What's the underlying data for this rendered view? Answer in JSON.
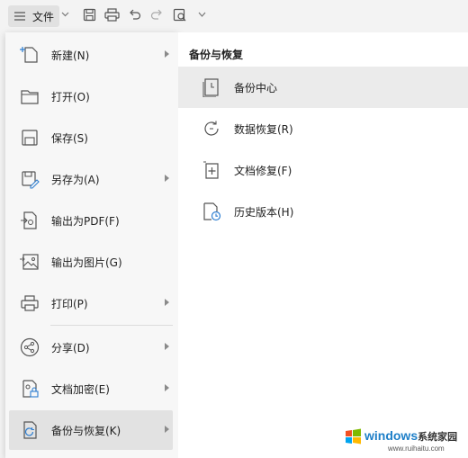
{
  "toolbar": {
    "file_label": "文件",
    "icons": [
      "menu-icon",
      "chevron-down-icon",
      "save-icon",
      "print-icon",
      "undo-icon",
      "redo-icon",
      "print-preview-icon",
      "more-icon"
    ]
  },
  "menu": {
    "items": [
      {
        "label": "新建(N)",
        "icon": "new-file-icon",
        "has_submenu": true
      },
      {
        "label": "打开(O)",
        "icon": "folder-icon",
        "has_submenu": false
      },
      {
        "label": "保存(S)",
        "icon": "save-icon",
        "has_submenu": false
      },
      {
        "label": "另存为(A)",
        "icon": "save-as-icon",
        "has_submenu": true
      },
      {
        "label": "输出为PDF(F)",
        "icon": "pdf-export-icon",
        "has_submenu": false
      },
      {
        "label": "输出为图片(G)",
        "icon": "image-export-icon",
        "has_submenu": false
      },
      {
        "label": "打印(P)",
        "icon": "print-icon",
        "has_submenu": true
      },
      {
        "label": "分享(D)",
        "icon": "share-icon",
        "has_submenu": true
      },
      {
        "label": "文档加密(E)",
        "icon": "lock-document-icon",
        "has_submenu": true
      },
      {
        "label": "备份与恢复(K)",
        "icon": "backup-icon",
        "has_submenu": true,
        "active": true
      }
    ]
  },
  "submenu": {
    "title": "备份与恢复",
    "items": [
      {
        "label": "备份中心",
        "icon": "backup-center-icon",
        "active": true
      },
      {
        "label": "数据恢复(R)",
        "icon": "data-recovery-icon"
      },
      {
        "label": "文档修复(F)",
        "icon": "document-repair-icon"
      },
      {
        "label": "历史版本(H)",
        "icon": "history-version-icon"
      }
    ]
  },
  "watermark": {
    "brand": "windows",
    "suffix": "系统家园",
    "url": "www.ruihaitu.com"
  },
  "colors": {
    "toolbar_bg": "#f3f3f3",
    "menu_bg": "#f7f7f7",
    "active_item_bg": "#e2e2e2",
    "submenu_bg": "#ffffff",
    "submenu_active_bg": "#ebebeb",
    "icon_stroke": "#555555",
    "watermark_blue": "#1e7fc8"
  }
}
